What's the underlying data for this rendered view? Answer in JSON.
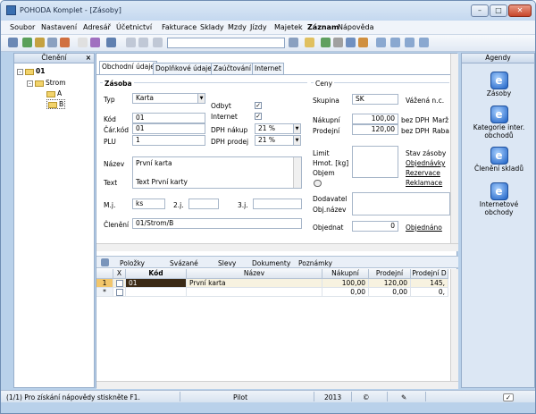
{
  "window": {
    "title": "POHODA Komplet - [Zásoby]"
  },
  "menu": [
    "Soubor",
    "Nastavení",
    "Adresář",
    "Účetnictví",
    "Fakturace",
    "Sklady",
    "Mzdy",
    "Jízdy",
    "Majetek",
    "Záznam",
    "Nápověda"
  ],
  "left_panel": {
    "title": "Členění",
    "close": "×",
    "tree": [
      "01",
      "Strom",
      "A",
      "B"
    ]
  },
  "tabs": [
    "Obchodní údaje",
    "Doplňkové údaje",
    "Zaúčtování",
    "Internet"
  ],
  "zasoba": {
    "title": "Zásoba",
    "typ_label": "Typ",
    "typ_value": "Karta",
    "odbyt_label": "Odbyt",
    "internet_label": "Internet",
    "kod_label": "Kód",
    "kod_value": "01",
    "carkod_label": "Čár.kód",
    "carkod_value": "01",
    "plu_label": "PLU",
    "plu_value": "1",
    "dph_nakup_label": "DPH nákup",
    "dph_nakup_value": "21 %",
    "dph_prodej_label": "DPH prodej",
    "dph_prodej_value": "21 %",
    "nazev_label": "Název",
    "nazev_value": "První karta",
    "text_label": "Text",
    "text_value": "Text První karty",
    "mj_label": "M.j.",
    "mj_value": "ks",
    "mj2_label": "2.j.",
    "mj3_label": "3.j.",
    "cleneni_label": "Členění",
    "cleneni_value": "01/Strom/B"
  },
  "ceny": {
    "title": "Ceny",
    "skupina_label": "Skupina",
    "skupina_value": "SK",
    "vazena": "Vážená n.c.",
    "nakupni_label": "Nákupní",
    "nakupni_value": "100,00",
    "nakupni_unit": "bez DPH",
    "marze": "Marž",
    "prodejni_label": "Prodejní",
    "prodejni_value": "120,00",
    "prodejni_unit": "bez DPH",
    "rabat": "Raba",
    "limit_label": "Limit",
    "hmot_label": "Hmot. [kg]",
    "objem_label": "Objem",
    "stav_label": "Stav zásoby",
    "objednavky": "Objednávky",
    "rezervace": "Rezervace",
    "reklamace": "Reklamace",
    "dodavatel_label": "Dodavatel",
    "objnazev_label": "Obj.název",
    "objednat_label": "Objednat",
    "objednat_value": "0",
    "objednano": "Objednáno"
  },
  "bottom_tabs": [
    "Položky",
    "Svázané",
    "Slevy",
    "Dokumenty",
    "Poznámky"
  ],
  "grid": {
    "headers": [
      "X",
      "Kód",
      "Název",
      "Nákupní",
      "Prodejní",
      "Prodejní D"
    ],
    "rows": [
      {
        "num": "1",
        "kod": "01",
        "nazev": "První karta",
        "nakupni": "100,00",
        "prodejni": "120,00",
        "prodejni_d": "145,"
      },
      {
        "num": "*",
        "kod": "",
        "nazev": "",
        "nakupni": "0,00",
        "prodejni": "0,00",
        "prodejni_d": "0,"
      }
    ]
  },
  "right_panel": {
    "title": "Agendy",
    "items": [
      "Zásoby",
      "Kategorie inter. obchodů",
      "Členění skladů",
      "Internetové obchody"
    ]
  },
  "status": {
    "help": "(1/1) Pro získání nápovědy stiskněte F1.",
    "mode": "Pilot",
    "year": "2013"
  }
}
